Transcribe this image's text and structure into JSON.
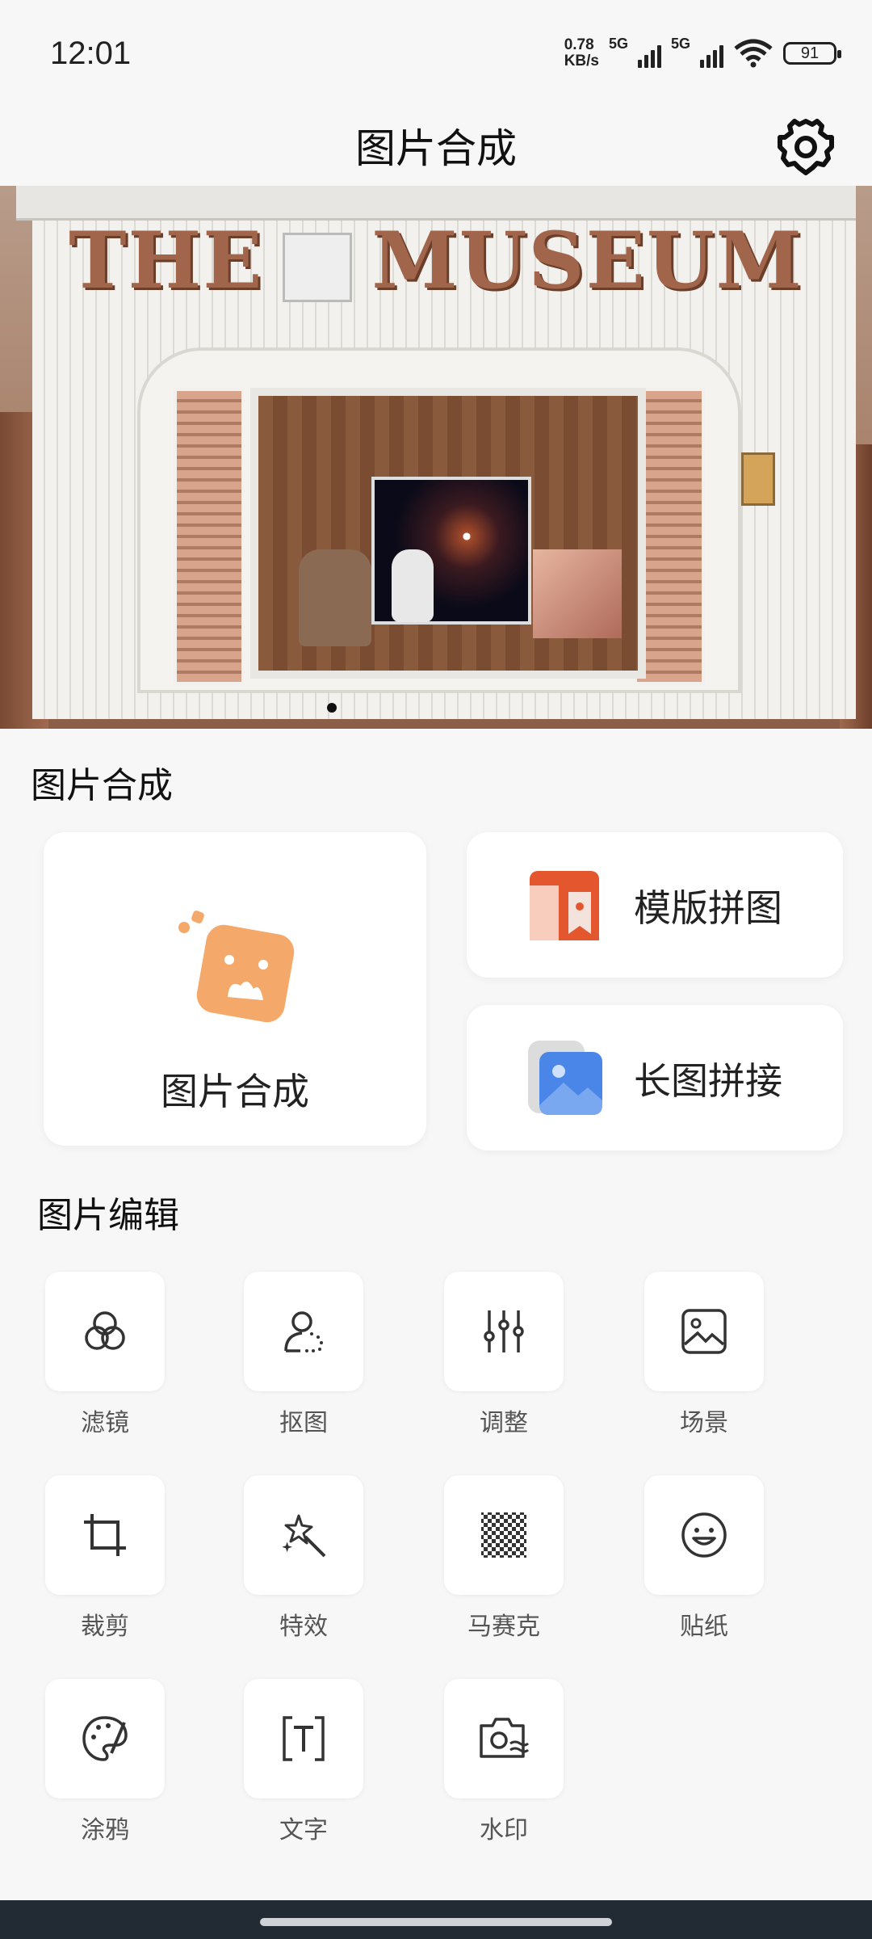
{
  "status_bar": {
    "time": "12:01",
    "speed_value": "0.78",
    "speed_unit": "KB/s",
    "sim1_label": "5G",
    "sim2_label": "5G",
    "battery": "91"
  },
  "app_bar": {
    "title": "图片合成",
    "settings_icon": "gear-icon"
  },
  "banner": {
    "sign_left": "THE",
    "sign_right": "MUSEUM",
    "slide_count": 1,
    "active_slide": 0
  },
  "compose_section": {
    "title": "图片合成",
    "main_card": {
      "label": "图片合成",
      "icon": "photo-compose-icon",
      "accent": "#f4a96a"
    },
    "template_card": {
      "label": "模版拼图",
      "icon": "template-collage-icon",
      "accent": "#e4572e"
    },
    "long_card": {
      "label": "长图拼接",
      "icon": "long-image-stitch-icon",
      "accent": "#4a86e8"
    }
  },
  "edit_section": {
    "title": "图片编辑",
    "tools": [
      {
        "label": "滤镜",
        "icon": "filter-icon"
      },
      {
        "label": "抠图",
        "icon": "cutout-icon"
      },
      {
        "label": "调整",
        "icon": "adjust-sliders-icon"
      },
      {
        "label": "场景",
        "icon": "scene-image-icon"
      },
      {
        "label": "裁剪",
        "icon": "crop-icon"
      },
      {
        "label": "特效",
        "icon": "magic-wand-icon"
      },
      {
        "label": "马赛克",
        "icon": "mosaic-icon"
      },
      {
        "label": "贴纸",
        "icon": "sticker-smile-icon"
      },
      {
        "label": "涂鸦",
        "icon": "palette-icon"
      },
      {
        "label": "文字",
        "icon": "text-icon"
      },
      {
        "label": "水印",
        "icon": "watermark-camera-icon"
      }
    ]
  }
}
